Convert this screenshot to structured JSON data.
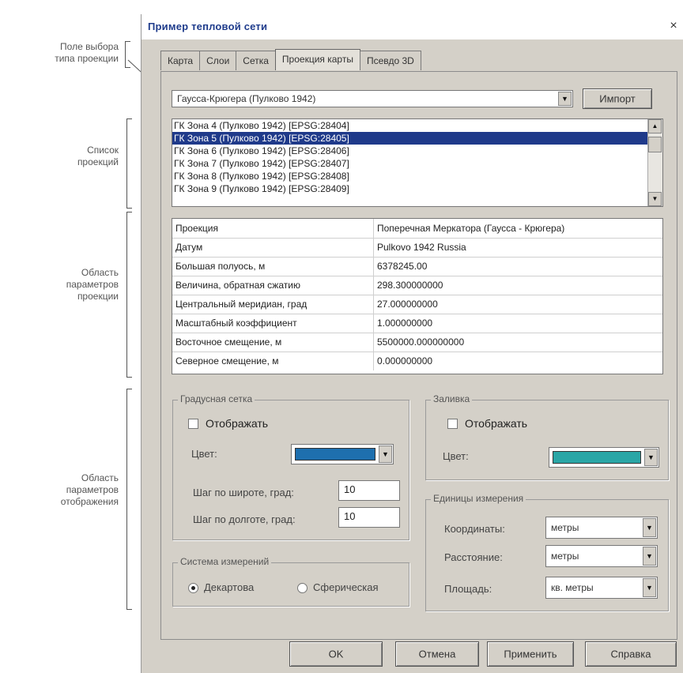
{
  "annotations": {
    "selector": [
      "Поле выбора",
      "типа проекции"
    ],
    "list": [
      "Список",
      "проекций"
    ],
    "params": [
      "Область",
      "параметров",
      "проекции"
    ],
    "display": [
      "Область",
      "параметров",
      "отображения"
    ]
  },
  "window": {
    "title": "Пример тепловой сети",
    "close_glyph": "×"
  },
  "tabs": [
    {
      "label": "Карта"
    },
    {
      "label": "Слои"
    },
    {
      "label": "Сетка"
    },
    {
      "label": "Проекция карты",
      "active": true
    },
    {
      "label": "Псевдо 3D"
    }
  ],
  "projection_type": {
    "value": "Гаусса-Крюгера (Пулково 1942)",
    "import_label": "Импорт"
  },
  "projection_list": {
    "items": [
      "ГК Зона 4 (Пулково 1942) [EPSG:28404]",
      "ГК Зона 5 (Пулково 1942) [EPSG:28405]",
      "ГК Зона 6 (Пулково 1942) [EPSG:28406]",
      "ГК Зона 7 (Пулково 1942) [EPSG:28407]",
      "ГК Зона 8 (Пулково 1942) [EPSG:28408]",
      "ГК Зона 9 (Пулково 1942) [EPSG:28409]"
    ],
    "selected_index": 1,
    "scroll_up": "▲",
    "scroll_down": "▼"
  },
  "params": [
    {
      "key": "Проекция",
      "value": "Поперечная Меркатора (Гаусса - Крюгера)"
    },
    {
      "key": "Датум",
      "value": "Pulkovo 1942 Russia"
    },
    {
      "key": "Большая полуось, м",
      "value": "6378245.00"
    },
    {
      "key": "Величина, обратная сжатию",
      "value": "298.300000000"
    },
    {
      "key": "Центральный меридиан, град",
      "value": "27.000000000"
    },
    {
      "key": "Масштабный коэффициент",
      "value": "1.000000000"
    },
    {
      "key": "Восточное смещение, м",
      "value": "5500000.000000000"
    },
    {
      "key": "Северное смещение, м",
      "value": "0.000000000"
    }
  ],
  "graticule": {
    "title": "Градусная сетка",
    "show_label": "Отображать",
    "show_checked": false,
    "color_label": "Цвет:",
    "color": "#1e6fae",
    "lat_step_label": "Шаг по широте, град:",
    "lat_step": "10",
    "lon_step_label": "Шаг по долготе, град:",
    "lon_step": "10"
  },
  "fill": {
    "title": "Заливка",
    "show_label": "Отображать",
    "show_checked": false,
    "color_label": "Цвет:",
    "color": "#2aa6a6"
  },
  "measurement_system": {
    "title": "Система измерений",
    "options": [
      "Декартова",
      "Сферическая"
    ],
    "selected_index": 0
  },
  "units": {
    "title": "Единицы измерения",
    "coordinates_label": "Координаты:",
    "coordinates_value": "метры",
    "distance_label": "Расстояние:",
    "distance_value": "метры",
    "area_label": "Площадь:",
    "area_value": "кв. метры"
  },
  "buttons": {
    "ok": "OK",
    "cancel": "Отмена",
    "apply": "Применить",
    "help": "Справка"
  },
  "dropdown_glyph": "▼"
}
